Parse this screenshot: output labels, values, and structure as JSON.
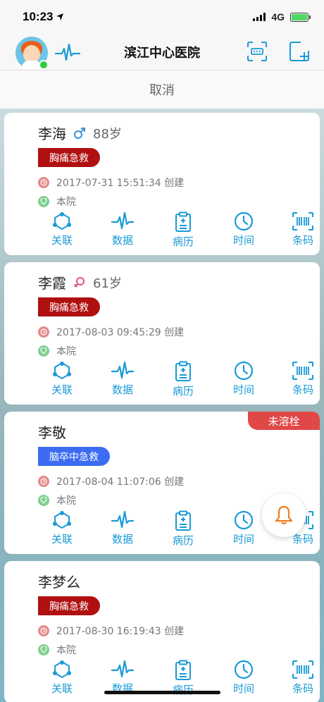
{
  "status_bar": {
    "time": "10:23",
    "network": "4G"
  },
  "nav": {
    "title": "滨江中心医院"
  },
  "cancel_label": "取消",
  "cards": [
    {
      "name": "李海",
      "gender": "male",
      "age": "88岁",
      "tag": "胸痛急救",
      "tag_color": "#b01010",
      "created": "2017-07-31 15:51:34 创建",
      "place": "本院",
      "badge": ""
    },
    {
      "name": "李霞",
      "gender": "female",
      "age": "61岁",
      "tag": "胸痛急救",
      "tag_color": "#b01010",
      "created": "2017-08-03 09:45:29 创建",
      "place": "本院",
      "badge": ""
    },
    {
      "name": "李敬",
      "gender": "",
      "age": "",
      "tag": "脑卒中急救",
      "tag_color": "#3b6cf2",
      "created": "2017-08-04 11:07:06 创建",
      "place": "本院",
      "badge": "未溶栓"
    },
    {
      "name": "李梦么",
      "gender": "",
      "age": "",
      "tag": "胸痛急救",
      "tag_color": "#b01010",
      "created": "2017-08-30 16:19:43 创建",
      "place": "本院",
      "badge": ""
    }
  ],
  "actions": [
    {
      "label": "关联",
      "icon": "link-icon"
    },
    {
      "label": "数据",
      "icon": "pulse-icon"
    },
    {
      "label": "病历",
      "icon": "clipboard-icon"
    },
    {
      "label": "时间",
      "icon": "clock-icon"
    },
    {
      "label": "条码",
      "icon": "barcode-icon"
    }
  ],
  "colors": {
    "accent": "#1a9ad6",
    "chest_pain": "#b01010",
    "stroke": "#3b6cf2",
    "badge": "#e04848"
  }
}
